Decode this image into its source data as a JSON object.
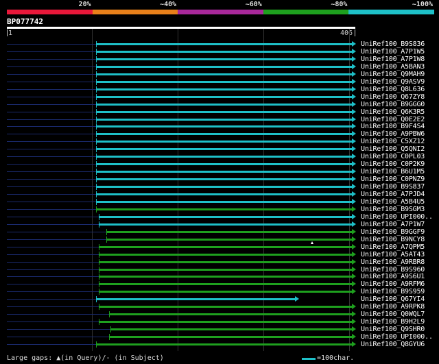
{
  "legend": {
    "labels": [
      "20%",
      "~40%",
      "~60%",
      "~80%",
      "~100%"
    ],
    "colors": [
      "#e8183a",
      "#e8801a",
      "#a8289a",
      "#1ea01e",
      "#1ec0c8"
    ]
  },
  "query": {
    "id": "BP077742",
    "start": "1",
    "end": "406",
    "length": 406
  },
  "hits": [
    {
      "label": "UniRef100_B9S836",
      "start": 105,
      "end": 406,
      "color": "cyan",
      "arrow": true
    },
    {
      "label": "UniRef100_A7P1W5",
      "start": 105,
      "end": 406,
      "color": "cyan",
      "arrow": true
    },
    {
      "label": "UniRef100_A7P1W8",
      "start": 105,
      "end": 406,
      "color": "cyan",
      "arrow": true
    },
    {
      "label": "UniRef100_A5BAN3",
      "start": 105,
      "end": 406,
      "color": "cyan",
      "arrow": true
    },
    {
      "label": "UniRef100_Q9MAH9",
      "start": 105,
      "end": 406,
      "color": "cyan",
      "arrow": true
    },
    {
      "label": "UniRef100_Q9ASV9",
      "start": 105,
      "end": 406,
      "color": "cyan",
      "arrow": true
    },
    {
      "label": "UniRef100_Q8L636",
      "start": 105,
      "end": 406,
      "color": "cyan",
      "arrow": true
    },
    {
      "label": "UniRef100_Q67ZY8",
      "start": 105,
      "end": 406,
      "color": "cyan",
      "arrow": true
    },
    {
      "label": "UniRef100_B9GGG0",
      "start": 105,
      "end": 406,
      "color": "cyan",
      "arrow": true
    },
    {
      "label": "UniRef100_Q6K3R5",
      "start": 105,
      "end": 406,
      "color": "cyan",
      "arrow": true
    },
    {
      "label": "UniRef100_Q0E2E2",
      "start": 105,
      "end": 406,
      "color": "cyan",
      "arrow": true
    },
    {
      "label": "UniRef100_B9F4S4",
      "start": 105,
      "end": 406,
      "color": "cyan",
      "arrow": true
    },
    {
      "label": "UniRef100_A9PBW6",
      "start": 105,
      "end": 406,
      "color": "cyan",
      "arrow": true
    },
    {
      "label": "UniRef100_C5XZ12",
      "start": 105,
      "end": 406,
      "color": "cyan",
      "arrow": true
    },
    {
      "label": "UniRef100_Q5QNI2",
      "start": 105,
      "end": 406,
      "color": "cyan",
      "arrow": true
    },
    {
      "label": "UniRef100_C0PL03",
      "start": 105,
      "end": 406,
      "color": "cyan",
      "arrow": true
    },
    {
      "label": "UniRef100_C0P2K9",
      "start": 105,
      "end": 406,
      "color": "cyan",
      "arrow": true
    },
    {
      "label": "UniRef100_B6U1M5",
      "start": 105,
      "end": 406,
      "color": "cyan",
      "arrow": true
    },
    {
      "label": "UniRef100_C0PNZ9",
      "start": 105,
      "end": 406,
      "color": "cyan",
      "arrow": true
    },
    {
      "label": "UniRef100_B9S837",
      "start": 105,
      "end": 406,
      "color": "cyan",
      "arrow": true
    },
    {
      "label": "UniRef100_A7PJD4",
      "start": 105,
      "end": 406,
      "color": "cyan",
      "arrow": true
    },
    {
      "label": "UniRef100_A5B4U5",
      "start": 105,
      "end": 406,
      "color": "cyan",
      "arrow": true
    },
    {
      "label": "UniRef100_B9SGM3",
      "start": 105,
      "end": 406,
      "color": "green",
      "arrow": true
    },
    {
      "label": "UniRef100_UPI000..",
      "start": 108,
      "end": 406,
      "color": "cyan",
      "arrow": true
    },
    {
      "label": "UniRef100_A7P1W7",
      "start": 108,
      "end": 406,
      "color": "cyan",
      "arrow": true
    },
    {
      "label": "UniRef100_B9GGF9",
      "start": 117,
      "end": 406,
      "color": "green",
      "arrow": true
    },
    {
      "label": "UniRef100_B9NCY8",
      "start": 117,
      "end": 406,
      "color": "green",
      "arrow": true,
      "gap_mark": 354
    },
    {
      "label": "UniRef100_A7QPM5",
      "start": 108,
      "end": 406,
      "color": "green",
      "arrow": true
    },
    {
      "label": "UniRef100_A5AT43",
      "start": 108,
      "end": 406,
      "color": "green",
      "arrow": true
    },
    {
      "label": "UniRef100_A9RBR8",
      "start": 108,
      "end": 406,
      "color": "green",
      "arrow": true
    },
    {
      "label": "UniRef100_B9S960",
      "start": 108,
      "end": 406,
      "color": "green",
      "arrow": true
    },
    {
      "label": "UniRef100_A9S6U1",
      "start": 108,
      "end": 406,
      "color": "green",
      "arrow": true
    },
    {
      "label": "UniRef100_A9RFM6",
      "start": 108,
      "end": 406,
      "color": "green",
      "arrow": true
    },
    {
      "label": "UniRef100_B9S959",
      "start": 108,
      "end": 406,
      "color": "green",
      "arrow": true
    },
    {
      "label": "UniRef100_Q67YI4",
      "start": 105,
      "end": 340,
      "color": "cyan",
      "arrow": true
    },
    {
      "label": "UniRef100_A9RPK8",
      "start": 108,
      "end": 406,
      "color": "green",
      "arrow": true
    },
    {
      "label": "UniRef100_Q0WQL7",
      "start": 120,
      "end": 406,
      "color": "green",
      "arrow": true
    },
    {
      "label": "UniRef100_B9H2L9",
      "start": 108,
      "end": 406,
      "color": "green",
      "arrow": true
    },
    {
      "label": "UniRef100_Q9SHR0",
      "start": 122,
      "end": 406,
      "color": "green",
      "arrow": true
    },
    {
      "label": "UniRef100_UPI000..",
      "start": 120,
      "end": 406,
      "color": "green",
      "arrow": true
    },
    {
      "label": "UniRef100_Q8GYU6",
      "start": 105,
      "end": 406,
      "color": "green",
      "arrow": true
    }
  ],
  "footer": {
    "gaps_text": "Large gaps: ▲(in Query)/- (in Subject)",
    "scale_text": "=100char."
  }
}
